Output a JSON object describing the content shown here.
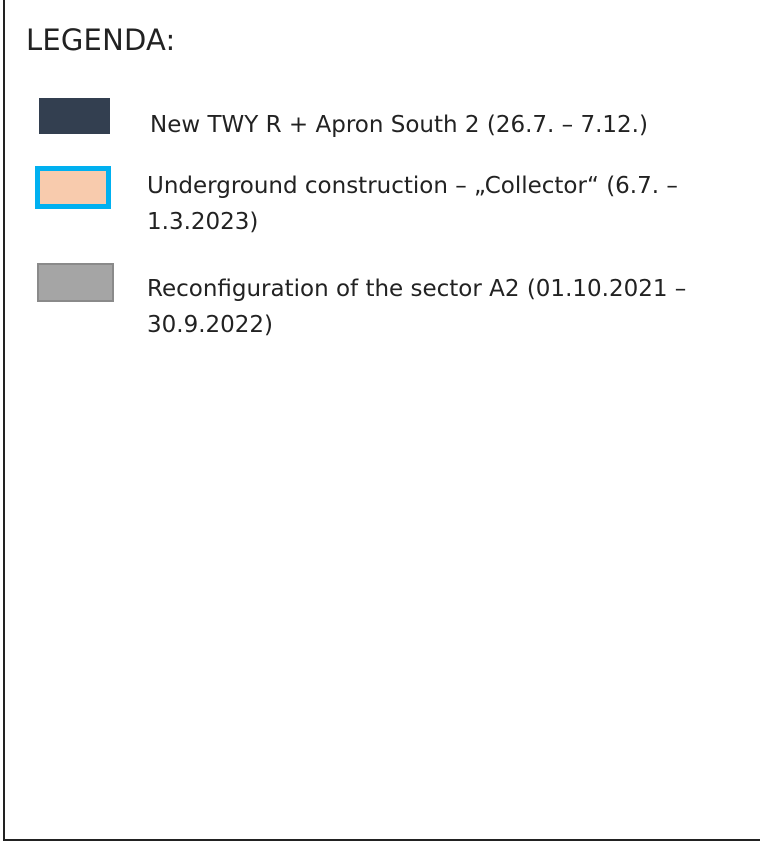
{
  "legend": {
    "title": "LEGENDA:",
    "items": [
      {
        "label": "New TWY R + Apron South 2 (26.7. – 7.12.)",
        "swatch_fill": "#333f50",
        "swatch_border": "none"
      },
      {
        "label": "Underground construction – „Collector“ (6.7. –\n1.3.2023)",
        "swatch_fill": "#f8cbad",
        "swatch_border": "#00b0f0"
      },
      {
        "label": "Reconfiguration of the sector A2 (01.10.2021 –\n30.9.2022)",
        "swatch_fill": "#a5a5a5",
        "swatch_border": "#8a8a8a"
      }
    ]
  }
}
